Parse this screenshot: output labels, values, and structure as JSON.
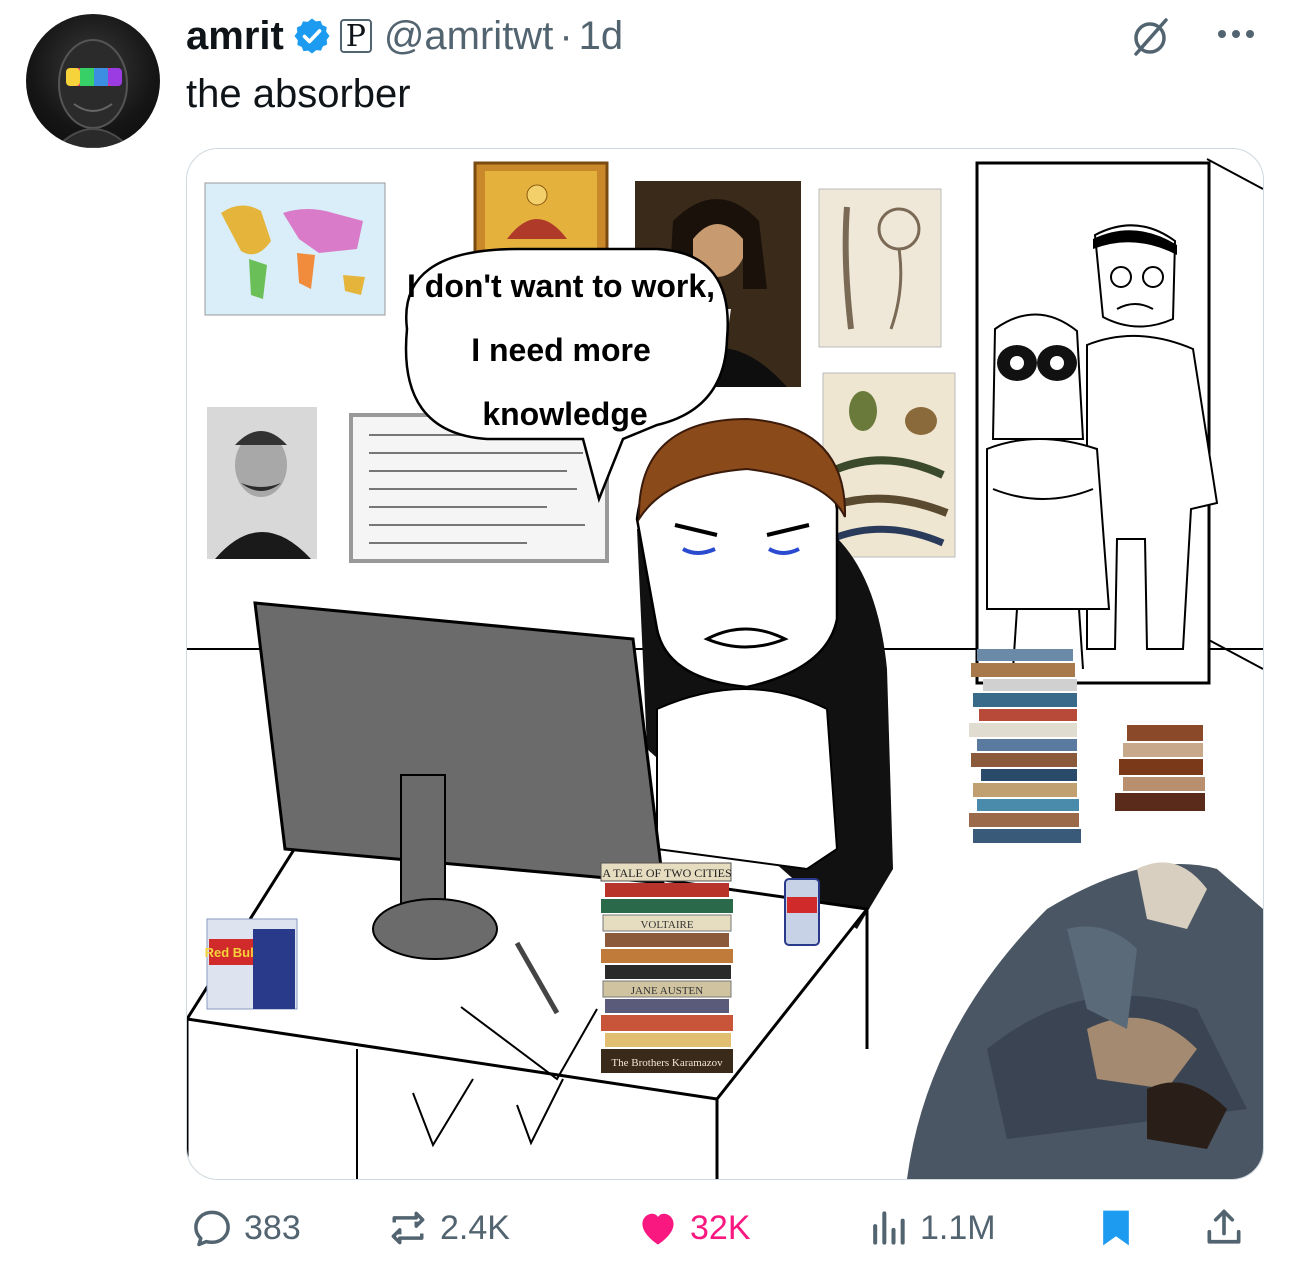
{
  "author": {
    "name": "amrit",
    "handle": "@amritwt",
    "affiliation_badge": "P",
    "separator": "·",
    "time": "1d",
    "verified_color": "#1d9bf0"
  },
  "post": {
    "text": "the absorber"
  },
  "meme": {
    "speech": [
      "I don't want to work,",
      "I need more",
      "knowledge"
    ],
    "book_spines": [
      "A TALE OF TWO CITIES",
      "VOLTAIRE",
      "JANE AUSTEN",
      "The Brothers Karamazov"
    ],
    "can_label": "Red Bull"
  },
  "actions": {
    "replies": "383",
    "reposts": "2.4K",
    "likes": "32K",
    "views": "1.1M",
    "like_color": "#f91880",
    "bookmark_color": "#1d9bf0"
  },
  "icons": [
    "avatar",
    "verified-icon",
    "grok-icon",
    "more-icon",
    "reply-icon",
    "repost-icon",
    "like-icon",
    "views-icon",
    "bookmark-icon",
    "share-icon"
  ]
}
